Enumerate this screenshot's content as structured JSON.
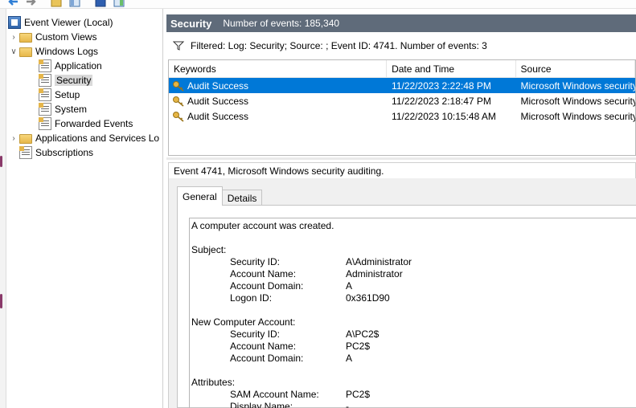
{
  "tree": {
    "items": [
      {
        "label": "Event Viewer (Local)"
      },
      {
        "label": "Custom Views"
      },
      {
        "label": "Windows Logs"
      },
      {
        "label": "Application"
      },
      {
        "label": "Security"
      },
      {
        "label": "Setup"
      },
      {
        "label": "System"
      },
      {
        "label": "Forwarded Events"
      },
      {
        "label": "Applications and Services Lo"
      },
      {
        "label": "Subscriptions"
      }
    ]
  },
  "header": {
    "log_name": "Security",
    "count_text": "Number of events: 185,340"
  },
  "filter": {
    "text": "Filtered: Log: Security; Source: ; Event ID: 4741. Number of events: 3"
  },
  "grid": {
    "columns": [
      "Keywords",
      "Date and Time",
      "Source"
    ],
    "rows": [
      {
        "keywords": "Audit Success",
        "date": "11/22/2023 2:22:48 PM",
        "source": "Microsoft Windows security"
      },
      {
        "keywords": "Audit Success",
        "date": "11/22/2023 2:18:47 PM",
        "source": "Microsoft Windows security"
      },
      {
        "keywords": "Audit Success",
        "date": "11/22/2023 10:15:48 AM",
        "source": "Microsoft Windows security"
      }
    ]
  },
  "event": {
    "title": "Event 4741, Microsoft Windows security auditing.",
    "tabs": [
      "General",
      "Details"
    ],
    "description": {
      "intro": "A computer account was created.",
      "subject_header": "Subject:",
      "subject": [
        {
          "label": "Security ID:",
          "value": "A\\Administrator"
        },
        {
          "label": "Account Name:",
          "value": "Administrator"
        },
        {
          "label": "Account Domain:",
          "value": "A"
        },
        {
          "label": "Logon ID:",
          "value": "0x361D90"
        }
      ],
      "new_account_header": "New Computer Account:",
      "new_account": [
        {
          "label": "Security ID:",
          "value": "A\\PC2$"
        },
        {
          "label": "Account Name:",
          "value": "PC2$"
        },
        {
          "label": "Account Domain:",
          "value": "A"
        }
      ],
      "attributes_header": "Attributes:",
      "attributes": [
        {
          "label": "SAM Account Name:",
          "value": "PC2$"
        },
        {
          "label": "Display Name:",
          "value": "-"
        }
      ]
    }
  }
}
